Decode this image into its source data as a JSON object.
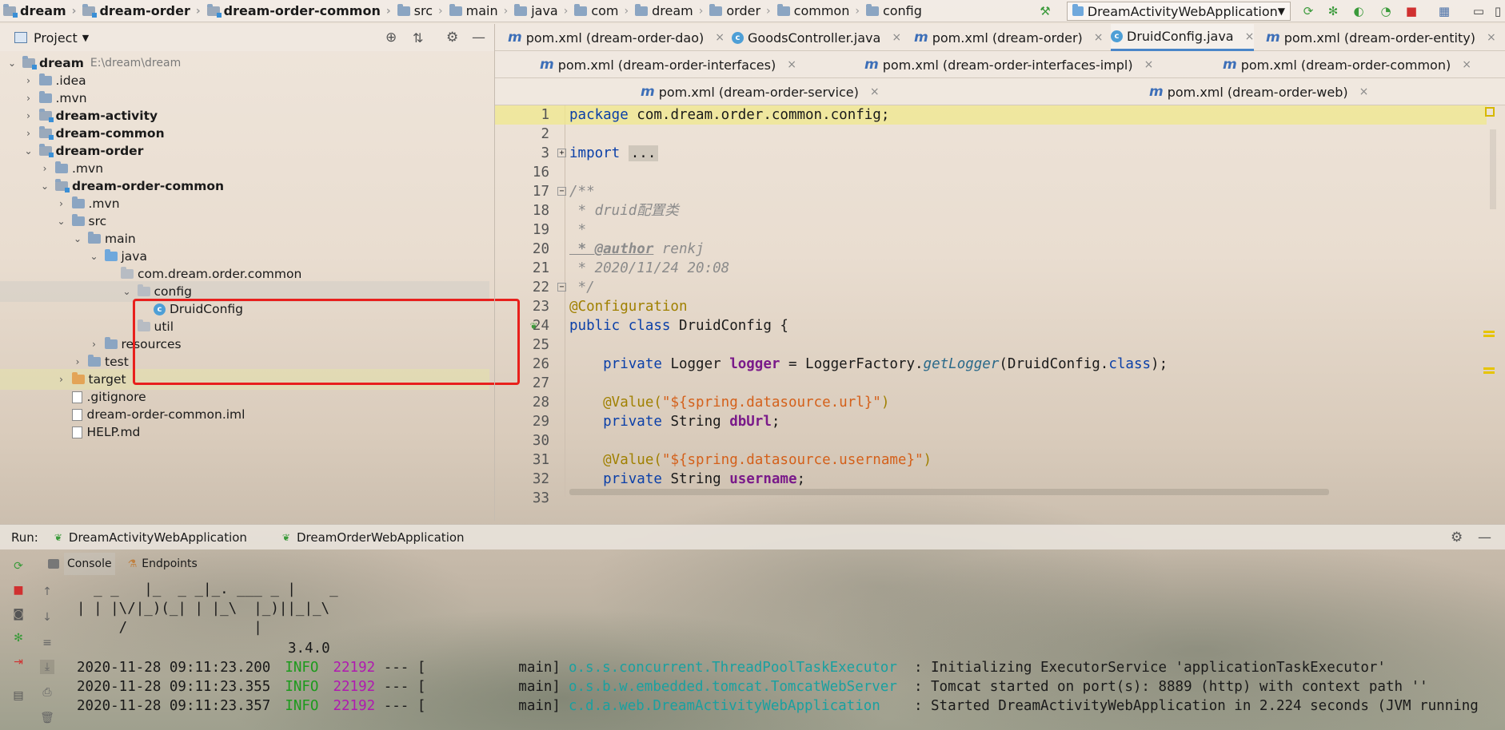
{
  "breadcrumb": [
    "dream",
    "dream-order",
    "dream-order-common",
    "src",
    "main",
    "java",
    "com",
    "dream",
    "order",
    "common",
    "config"
  ],
  "run_config": "DreamActivityWebApplication",
  "project_panel": {
    "title": "Project"
  },
  "tree": [
    {
      "label": "dream",
      "path": "E:\\dream\\dream",
      "bold": true,
      "depth": 0,
      "open": true,
      "icon": "module-folder"
    },
    {
      "label": ".idea",
      "depth": 1,
      "open": false,
      "icon": "folder"
    },
    {
      "label": ".mvn",
      "depth": 1,
      "open": false,
      "icon": "folder"
    },
    {
      "label": "dream-activity",
      "bold": true,
      "depth": 1,
      "open": false,
      "icon": "module-folder"
    },
    {
      "label": "dream-common",
      "bold": true,
      "depth": 1,
      "open": false,
      "icon": "module-folder"
    },
    {
      "label": "dream-order",
      "bold": true,
      "depth": 1,
      "open": true,
      "icon": "module-folder"
    },
    {
      "label": ".mvn",
      "depth": 2,
      "open": false,
      "icon": "folder"
    },
    {
      "label": "dream-order-common",
      "bold": true,
      "depth": 2,
      "open": true,
      "icon": "module-folder"
    },
    {
      "label": ".mvn",
      "depth": 3,
      "open": false,
      "icon": "folder"
    },
    {
      "label": "src",
      "depth": 3,
      "open": true,
      "icon": "folder"
    },
    {
      "label": "main",
      "depth": 4,
      "open": true,
      "icon": "folder"
    },
    {
      "label": "java",
      "depth": 5,
      "open": true,
      "icon": "source-folder"
    },
    {
      "label": "com.dream.order.common",
      "depth": 6,
      "icon": "package"
    },
    {
      "label": "config",
      "depth": 7,
      "open": true,
      "icon": "package",
      "selected": true
    },
    {
      "label": "DruidConfig",
      "depth": 8,
      "icon": "class"
    },
    {
      "label": "util",
      "depth": 7,
      "icon": "package"
    },
    {
      "label": "resources",
      "depth": 5,
      "open": false,
      "icon": "folder"
    },
    {
      "label": "test",
      "depth": 4,
      "open": false,
      "icon": "folder"
    },
    {
      "label": "target",
      "depth": 3,
      "open": false,
      "icon": "orange-folder",
      "highlight": true
    },
    {
      "label": ".gitignore",
      "depth": 3,
      "icon": "file"
    },
    {
      "label": "dream-order-common.iml",
      "depth": 3,
      "icon": "file"
    },
    {
      "label": "HELP.md",
      "depth": 3,
      "icon": "md-file"
    }
  ],
  "tabs_row1": [
    {
      "label": "pom.xml (dream-order-dao)",
      "icon": "m"
    },
    {
      "label": "GoodsController.java",
      "icon": "c"
    },
    {
      "label": "pom.xml (dream-order)",
      "icon": "m"
    },
    {
      "label": "DruidConfig.java",
      "icon": "c",
      "active": true
    },
    {
      "label": "pom.xml (dream-order-entity)",
      "icon": "m"
    }
  ],
  "tabs_row2": [
    {
      "label": "pom.xml (dream-order-interfaces)",
      "icon": "m"
    },
    {
      "label": "pom.xml (dream-order-interfaces-impl)",
      "icon": "m"
    },
    {
      "label": "pom.xml (dream-order-common)",
      "icon": "m"
    }
  ],
  "tabs_row3": [
    {
      "label": "pom.xml (dream-order-service)",
      "icon": "m"
    },
    {
      "label": "pom.xml (dream-order-web)",
      "icon": "m"
    }
  ],
  "code_lines": [
    "1",
    "2",
    "3",
    "16",
    "17",
    "18",
    "19",
    "20",
    "21",
    "22",
    "23",
    "24",
    "25",
    "26",
    "27",
    "28",
    "29",
    "30",
    "31",
    "32",
    "33"
  ],
  "code": {
    "pkg_kw": "package",
    "pkg_name": " com.dream.order.common.config;",
    "import_kw": "import",
    "import_ellipsis": "...",
    "c_open": "/**",
    "c_desc": " * druid配置类",
    "c_star": " *",
    "c_author_tag": " * @author",
    "c_author": " renkj",
    "c_date": " * 2020/11/24 20:08",
    "c_close": " */",
    "ann_config": "@Configuration",
    "l24_kw": "public class",
    "l24_name": " DruidConfig {",
    "l26_kw": "    private",
    "l26_type": " Logger ",
    "l26_field": "logger",
    "l26_eq": " = LoggerFactory.",
    "l26_m": "getLogger",
    "l26_rest": "(DruidConfig.",
    "l26_kw2": "class",
    "l26_end": ");",
    "l28_ann": "    @Value(",
    "l28_str": "\"${spring.datasource.url}\"",
    "l28_end": ")",
    "l29_kw": "    private",
    "l29_type": " String ",
    "l29_field": "dbUrl",
    "l29_end": ";",
    "l31_ann": "    @Value(",
    "l31_str": "\"${spring.datasource.username}\"",
    "l31_end": ")",
    "l32_kw": "    private",
    "l32_type": " String ",
    "l32_field": "username",
    "l32_end": ";"
  },
  "run": {
    "label": "Run:",
    "tabs": [
      "DreamActivityWebApplication",
      "DreamOrderWebApplication"
    ],
    "sub_tabs": [
      "Console",
      "Endpoints"
    ]
  },
  "console": {
    "banner": [
      "  _ _   |_  _ _|_. ___ _ |    _",
      "| | |\\/|_)(_| | |_\\  |_)||_|_\\",
      "     /               |"
    ],
    "version": "3.4.0",
    "logs": [
      {
        "ts": "2020-11-28 09:11:23.200",
        "level": "INFO",
        "pid": "22192",
        "sep": " --- [",
        "thread": "           main]",
        "logger": "o.s.s.concurrent.ThreadPoolTaskExecutor",
        "msg": "  : Initializing ExecutorService 'applicationTaskExecutor'"
      },
      {
        "ts": "2020-11-28 09:11:23.355",
        "level": "INFO",
        "pid": "22192",
        "sep": " --- [",
        "thread": "           main]",
        "logger": "o.s.b.w.embedded.tomcat.TomcatWebServer",
        "msg": "  : Tomcat started on port(s): 8889 (http) with context path ''"
      },
      {
        "ts": "2020-11-28 09:11:23.357",
        "level": "INFO",
        "pid": "22192",
        "sep": " --- [",
        "thread": "           main]",
        "logger": "c.d.a.web.DreamActivityWebApplication",
        "msg": "    : Started DreamActivityWebApplication in 2.224 seconds (JVM running"
      }
    ]
  }
}
